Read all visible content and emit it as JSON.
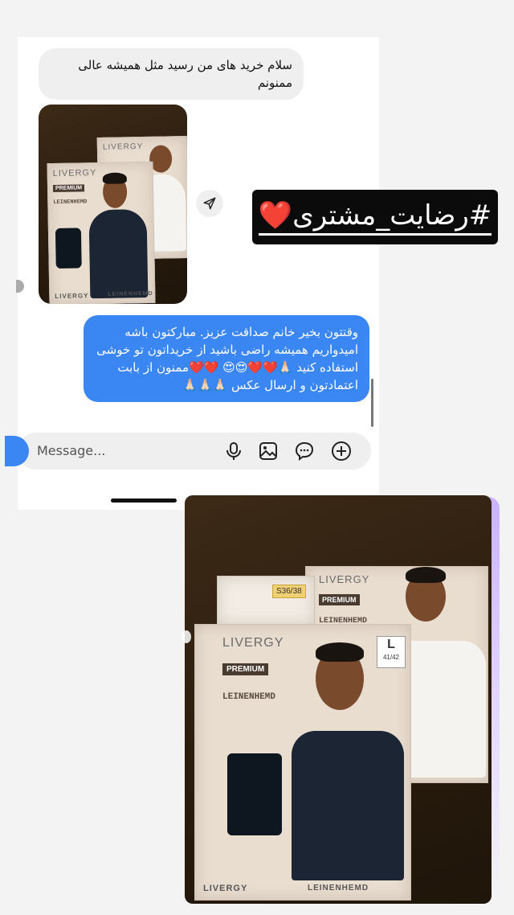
{
  "chat": {
    "incoming_message": "سلام خرید های من رسید مثل همیشه عالی ممنونم",
    "outgoing_message": "وقتتون بخیر خانم صداقت عزیز. مبارکتون باشه امیدواریم همیشه راضی باشید از خریداتون تو خوشی استفاده کنید 🙏🏻❤️❤️😍😍 ❤️❤️ممنون از بابت اعتمادتون و ارسال عکس 🙏🏻🙏🏻🙏🏻",
    "message_placeholder": "Message...",
    "icons": {
      "send": "send-icon",
      "mic": "microphone-icon",
      "gallery": "gallery-icon",
      "sticker": "sticker-icon",
      "add": "plus-circle-icon"
    }
  },
  "hashtag": {
    "text": "#رضایت_مشتری❤️"
  },
  "product_photo_small": {
    "brand": "LIVERGY",
    "tag": "PREMIUM",
    "name": "LEINENHEMD",
    "bottom_brand": "LIVERGY",
    "bottom_name": "LEINENHEMD"
  },
  "product_photo_large": {
    "brand_back": "LIVERGY",
    "tag_back": "PREMIUM",
    "name_back": "LEINENHEMD",
    "size_sticker": "S36/38",
    "brand_front": "LIVERGY",
    "tag_front": "PREMIUM",
    "name_front": "LEINENHEMD",
    "size_badge": "L",
    "size_range": "41/42",
    "bottom_brand": "LIVERGY",
    "bottom_name": "LEINENHEMD"
  },
  "colors": {
    "outgoing_bubble": "#3a86f3",
    "incoming_bubble": "#efefef",
    "hashtag_bg": "#0b0b0b"
  }
}
